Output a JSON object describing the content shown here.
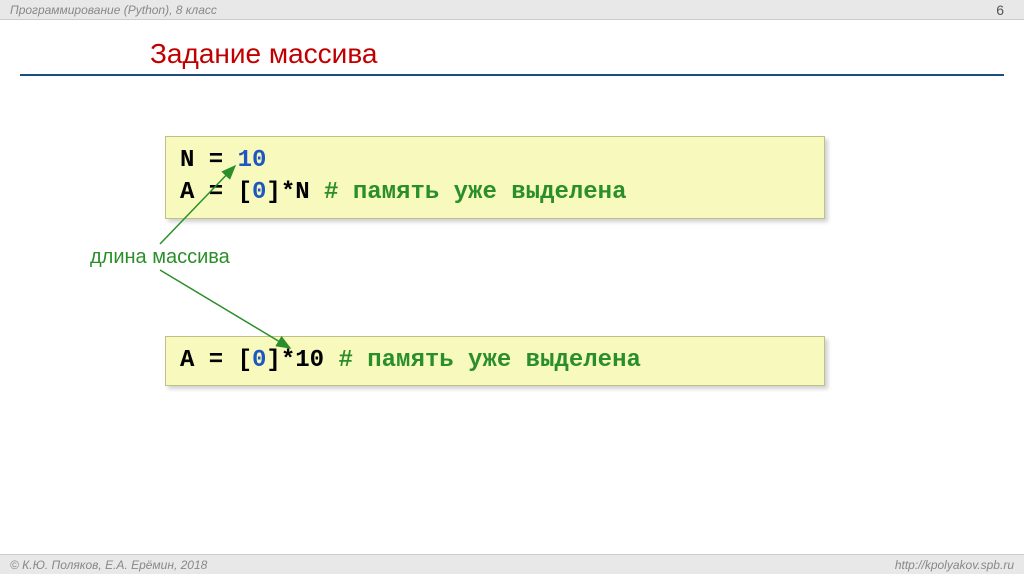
{
  "header": {
    "course": "Программирование (Python), 8 класс",
    "page_number": "6"
  },
  "title": "Задание массива",
  "code1": {
    "line1_var": "N",
    "line1_eq": " = ",
    "line1_val": "10",
    "line2_var": "A",
    "line2_eq": " = [",
    "line2_zero": "0",
    "line2_rest": "]*N  ",
    "line2_comment": "# память уже выделена"
  },
  "annotation": "длина массива",
  "code2": {
    "var": "A",
    "eq": " = [",
    "zero": "0",
    "rest": "]*10  ",
    "comment": "# память уже выделена"
  },
  "footer": {
    "copyright": "© К.Ю. Поляков, Е.А. Ерёмин, 2018",
    "url": "http://kpolyakov.spb.ru"
  }
}
